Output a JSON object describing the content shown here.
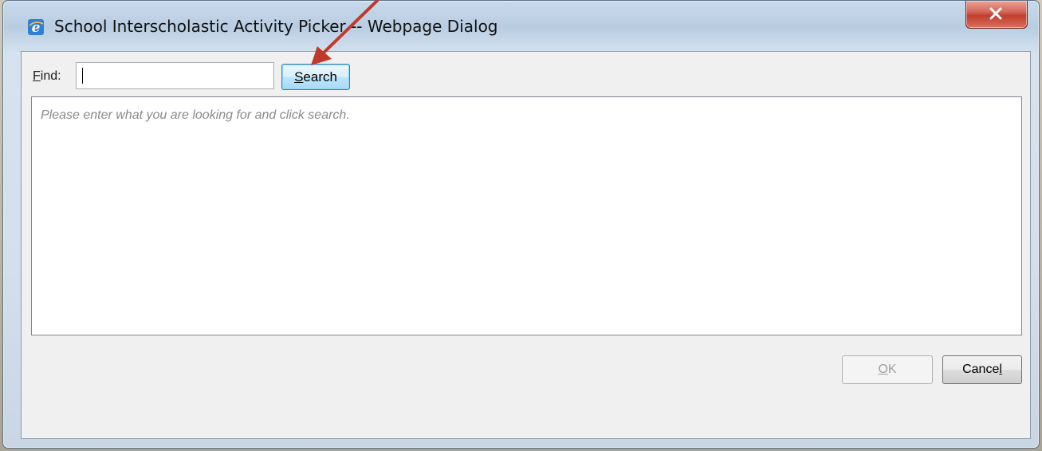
{
  "window": {
    "title": "School Interscholastic Activity Picker -- Webpage Dialog",
    "close_icon": "close-x-icon"
  },
  "search": {
    "label_accesskey": "F",
    "label_rest": "ind:",
    "value": "",
    "button_accesskey": "S",
    "button_rest": "earch"
  },
  "results": {
    "message": "Please enter what you are looking for and click search."
  },
  "footer": {
    "ok_accesskey": "O",
    "ok_rest": "K",
    "ok_enabled": false,
    "cancel_prefix": "Cance",
    "cancel_accesskey": "l"
  },
  "colors": {
    "annotation_arrow": "#c0392b",
    "close_button": "#c9473a"
  }
}
